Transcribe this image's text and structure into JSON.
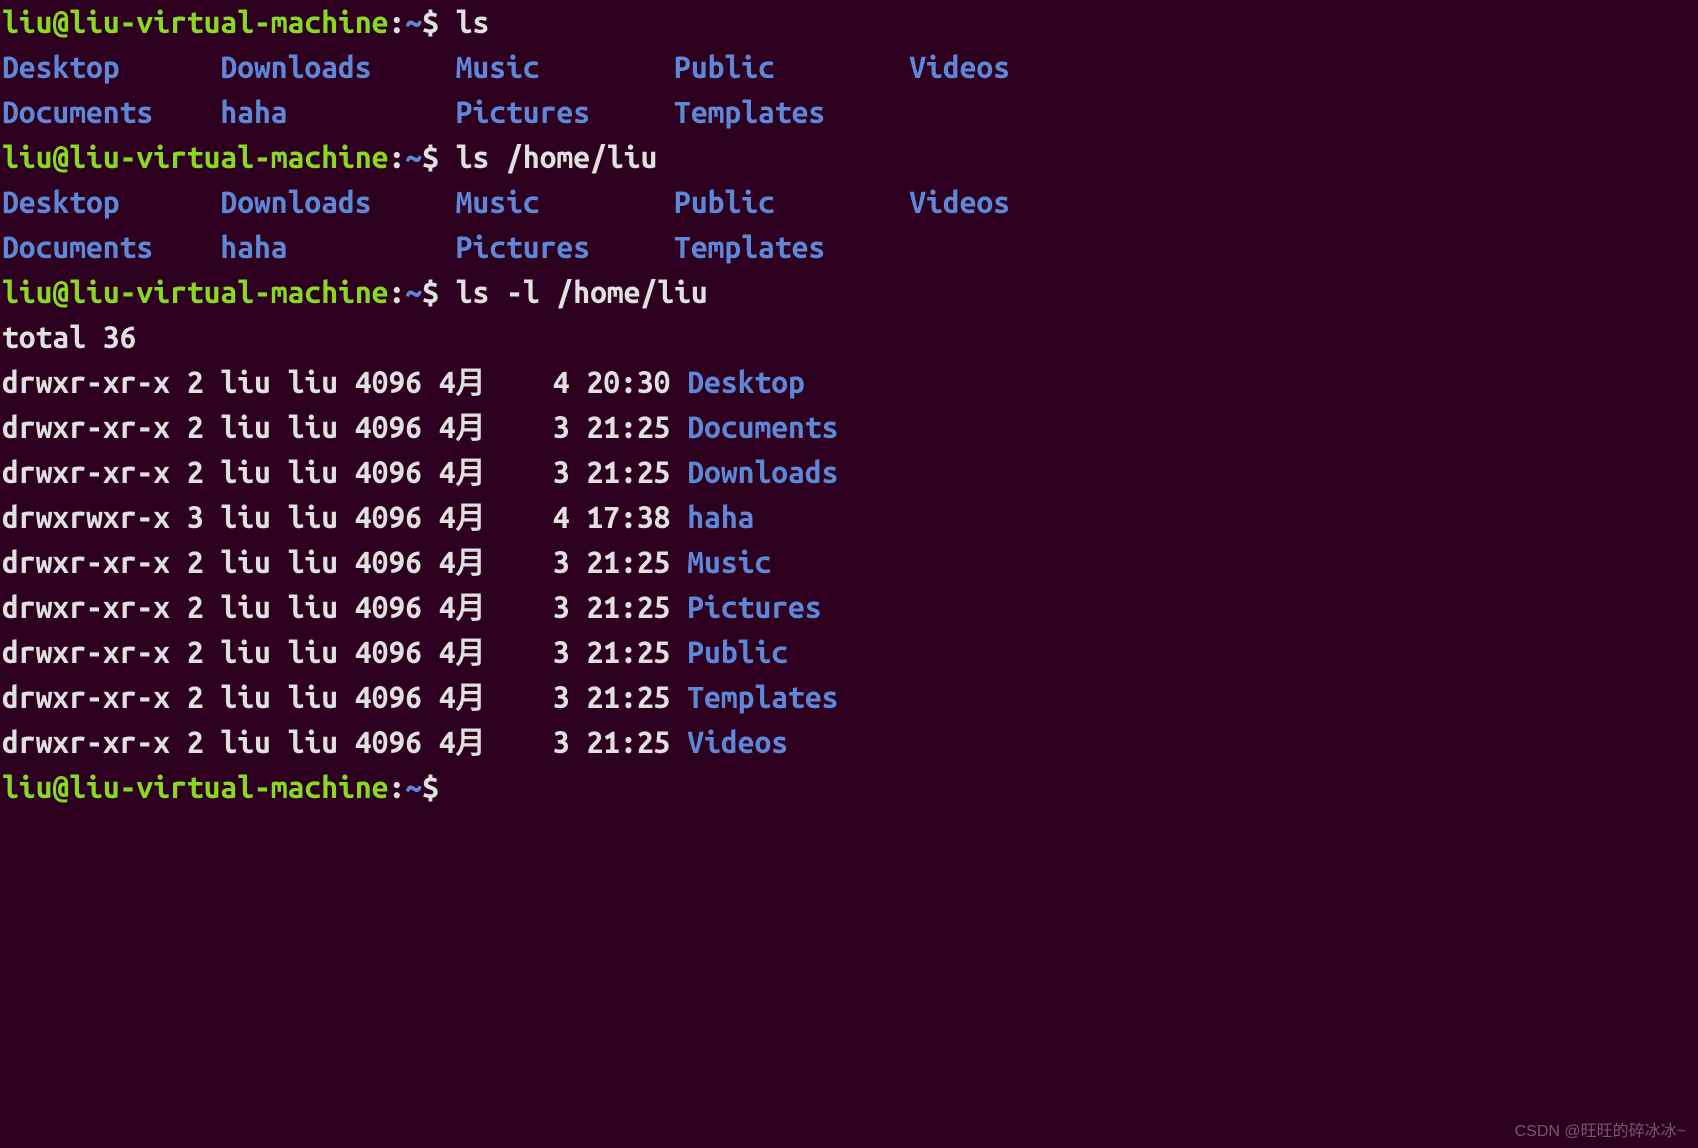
{
  "prompt": {
    "user": "liu",
    "at": "@",
    "host": "liu-virtual-machine",
    "colon": ":",
    "path": "~",
    "symbol": "$"
  },
  "commands": {
    "ls": "ls",
    "ls_home": "ls /home/liu",
    "ls_l_home": "ls -l /home/liu"
  },
  "ls_columns": [
    [
      "Desktop",
      "Downloads",
      "Music",
      "Public",
      "Videos"
    ],
    [
      "Documents",
      "haha",
      "Pictures",
      "Templates"
    ]
  ],
  "total_line": "total 36",
  "long_listing": [
    {
      "perm": "drwxr-xr-x",
      "links": "2",
      "owner": "liu",
      "group": "liu",
      "size": "4096",
      "month": "4月",
      "day": "4",
      "time": "20:30",
      "name": "Desktop"
    },
    {
      "perm": "drwxr-xr-x",
      "links": "2",
      "owner": "liu",
      "group": "liu",
      "size": "4096",
      "month": "4月",
      "day": "3",
      "time": "21:25",
      "name": "Documents"
    },
    {
      "perm": "drwxr-xr-x",
      "links": "2",
      "owner": "liu",
      "group": "liu",
      "size": "4096",
      "month": "4月",
      "day": "3",
      "time": "21:25",
      "name": "Downloads"
    },
    {
      "perm": "drwxrwxr-x",
      "links": "3",
      "owner": "liu",
      "group": "liu",
      "size": "4096",
      "month": "4月",
      "day": "4",
      "time": "17:38",
      "name": "haha"
    },
    {
      "perm": "drwxr-xr-x",
      "links": "2",
      "owner": "liu",
      "group": "liu",
      "size": "4096",
      "month": "4月",
      "day": "3",
      "time": "21:25",
      "name": "Music"
    },
    {
      "perm": "drwxr-xr-x",
      "links": "2",
      "owner": "liu",
      "group": "liu",
      "size": "4096",
      "month": "4月",
      "day": "3",
      "time": "21:25",
      "name": "Pictures"
    },
    {
      "perm": "drwxr-xr-x",
      "links": "2",
      "owner": "liu",
      "group": "liu",
      "size": "4096",
      "month": "4月",
      "day": "3",
      "time": "21:25",
      "name": "Public"
    },
    {
      "perm": "drwxr-xr-x",
      "links": "2",
      "owner": "liu",
      "group": "liu",
      "size": "4096",
      "month": "4月",
      "day": "3",
      "time": "21:25",
      "name": "Templates"
    },
    {
      "perm": "drwxr-xr-x",
      "links": "2",
      "owner": "liu",
      "group": "liu",
      "size": "4096",
      "month": "4月",
      "day": "3",
      "time": "21:25",
      "name": "Videos"
    }
  ],
  "col_widths": {
    "ls_cols": [
      13,
      14,
      13,
      14,
      0
    ],
    "perm": 11,
    "links": 2,
    "owner": 4,
    "group": 4,
    "size": 4,
    "month": 3,
    "day": 4,
    "time": 6
  },
  "watermark": "CSDN @旺旺的碎冰冰~"
}
